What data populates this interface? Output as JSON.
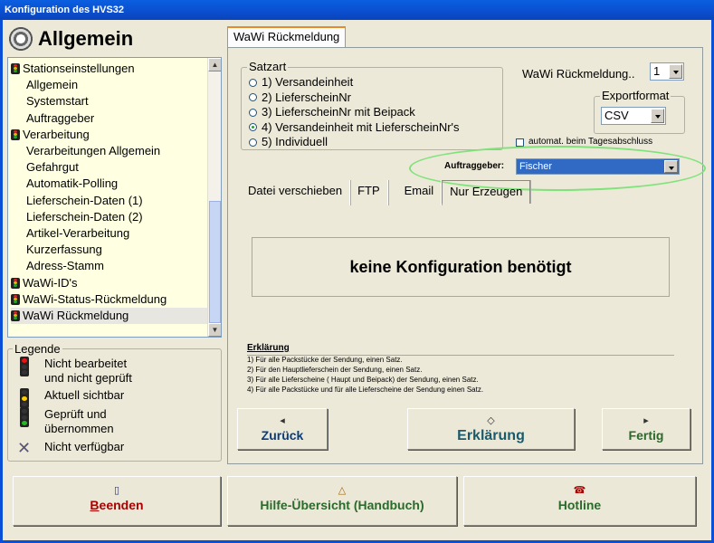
{
  "window": {
    "title": "Konfiguration des HVS32"
  },
  "header": {
    "title": "Allgemein"
  },
  "tree": {
    "items": [
      {
        "label": "Stationseinstellungen",
        "type": "cat"
      },
      {
        "label": "Allgemein",
        "type": "sub"
      },
      {
        "label": "Systemstart",
        "type": "sub"
      },
      {
        "label": "Auftraggeber",
        "type": "sub"
      },
      {
        "label": "Verarbeitung",
        "type": "cat"
      },
      {
        "label": "Verarbeitungen Allgemein",
        "type": "sub"
      },
      {
        "label": "Gefahrgut",
        "type": "sub"
      },
      {
        "label": "Automatik-Polling",
        "type": "sub"
      },
      {
        "label": "Lieferschein-Daten (1)",
        "type": "sub"
      },
      {
        "label": "Lieferschein-Daten (2)",
        "type": "sub"
      },
      {
        "label": "Artikel-Verarbeitung",
        "type": "sub"
      },
      {
        "label": "Kurzerfassung",
        "type": "sub"
      },
      {
        "label": "Adress-Stamm",
        "type": "sub"
      },
      {
        "label": "WaWi-ID's",
        "type": "cat"
      },
      {
        "label": "WaWi-Status-Rückmeldung",
        "type": "cat"
      },
      {
        "label": "WaWi Rückmeldung",
        "type": "cat",
        "selected": true
      }
    ]
  },
  "legend": {
    "title": "Legende",
    "items": [
      {
        "line1": "Nicht bearbeitet",
        "line2": "und nicht geprüft"
      },
      {
        "line1": "Aktuell sichtbar",
        "line2": ""
      },
      {
        "line1": "Geprüft und",
        "line2": "übernommen"
      },
      {
        "line1": "Nicht verfügbar",
        "line2": ""
      }
    ]
  },
  "tab": {
    "label": "WaWi Rückmeldung"
  },
  "satzart": {
    "label": "Satzart",
    "options": [
      "1) Versandeinheit",
      "2) LieferscheinNr",
      "3) LieferscheinNr mit Beipack",
      "4) Versandeinheit mit LieferscheinNr's",
      "5) Individuell"
    ],
    "selected_index": 3
  },
  "wawi_rueckmeldung": {
    "label": "WaWi Rückmeldung..",
    "value": "1"
  },
  "exportformat": {
    "label": "Exportformat",
    "value": "CSV"
  },
  "tagesabschluss": {
    "label": "automat. beim Tagesabschluss",
    "checked": false
  },
  "auftraggeber": {
    "label": "Auftraggeber:",
    "value": "Fischer"
  },
  "subtabs": [
    "Datei verschieben",
    "FTP",
    "Email",
    "Nur Erzeugen"
  ],
  "info": {
    "text": "keine Konfiguration benötigt"
  },
  "explanation": {
    "title": "Erklärung",
    "lines": [
      "1) Für alle Packstücke der Sendung, einen Satz.",
      "2) Für den Hauptlieferschein der Sendung, einen Satz.",
      "3) Für alle Lieferscheine ( Haupt und Beipack) der Sendung, einen Satz.",
      "4) Für alle Packstücke und für alle Lieferscheine der Sendung einen Satz."
    ]
  },
  "buttons": {
    "back": "Zurück",
    "explain": "Erklärung",
    "done": "Fertig",
    "quit_b": "B",
    "quit_rest": "eenden",
    "help": "Hilfe-Übersicht (Handbuch)",
    "hotline": "Hotline"
  }
}
